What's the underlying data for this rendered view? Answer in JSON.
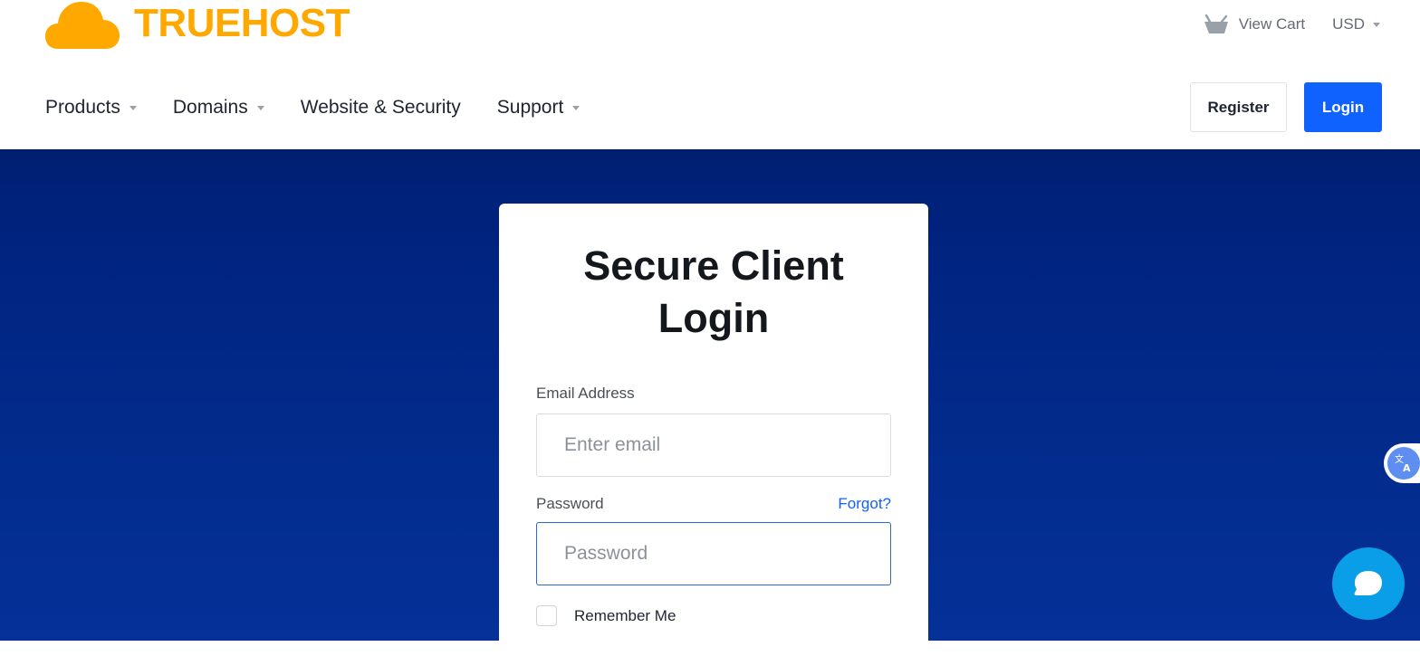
{
  "brand": {
    "name": "TRUEHOST",
    "color": "#ffa800"
  },
  "top_bar": {
    "cart_label": "View Cart",
    "cart_icon": "basket-icon",
    "currency": "USD"
  },
  "nav": {
    "items": [
      {
        "label": "Products",
        "has_dropdown": true
      },
      {
        "label": "Domains",
        "has_dropdown": true
      },
      {
        "label": "Website & Security",
        "has_dropdown": false
      },
      {
        "label": "Support",
        "has_dropdown": true
      }
    ],
    "register_label": "Register",
    "login_label": "Login"
  },
  "login_card": {
    "title": "Secure Client Login",
    "email_label": "Email Address",
    "email_placeholder": "Enter email",
    "email_value": "",
    "password_label": "Password",
    "forgot_label": "Forgot?",
    "password_placeholder": "Password",
    "password_value": "",
    "remember_label": "Remember Me",
    "remember_checked": false
  },
  "widgets": {
    "translate_icon": "translate-icon",
    "chat_icon": "chat-icon"
  },
  "colors": {
    "primary": "#1062fe",
    "hero_top": "#001f72",
    "hero_bottom": "#053198",
    "chat": "#0a9de8"
  }
}
